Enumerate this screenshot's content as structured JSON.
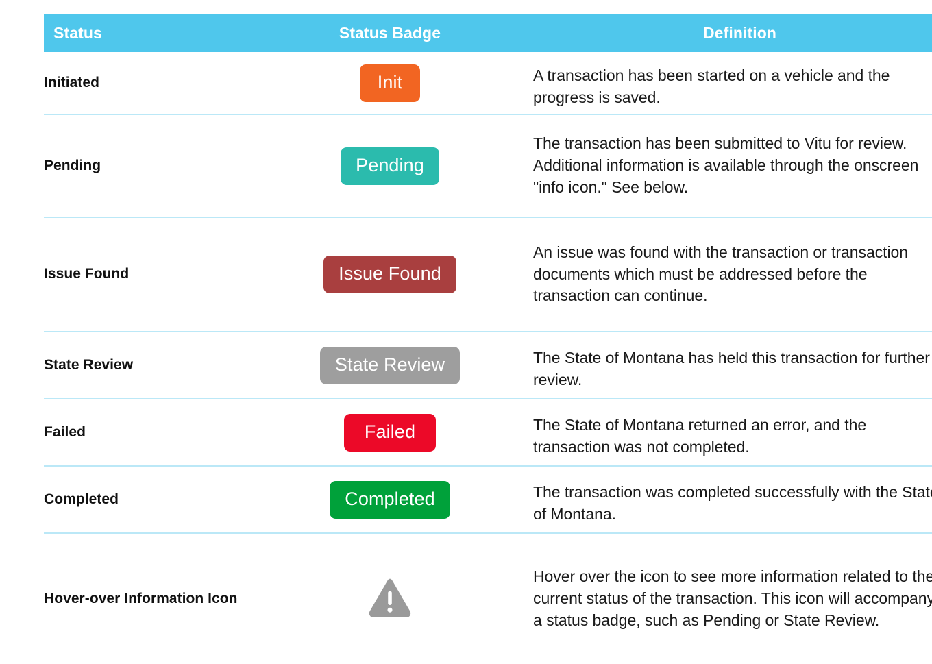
{
  "table": {
    "headers": {
      "status": "Status",
      "badge": "Status Badge",
      "definition": "Definition"
    },
    "header_bg": "#4FC7EC",
    "row_divider_color": "#BBE8F7",
    "rows": [
      {
        "status": "Initiated",
        "badge_label": "Init",
        "badge_color": "#F26522",
        "definition": "A transaction has been started on a vehicle and the progress is saved."
      },
      {
        "status": "Pending",
        "badge_label": "Pending",
        "badge_color": "#2BBBAD",
        "definition": "The transaction has been submitted to Vitu for review. Additional information is available through the onscreen \"info icon.\" See below."
      },
      {
        "status": "Issue Found",
        "badge_label": "Issue Found",
        "badge_color": "#A93F3F",
        "definition": "An issue was found with the transaction or transaction documents which must be addressed before the transaction can continue."
      },
      {
        "status": "State Review",
        "badge_label": "State Review",
        "badge_color": "#9E9E9E",
        "definition": "The State of Montana has held this transaction for further review."
      },
      {
        "status": "Failed",
        "badge_label": "Failed",
        "badge_color": "#EC0928",
        "definition": "The State of Montana returned an error, and the transaction was not completed."
      },
      {
        "status": "Completed",
        "badge_label": "Completed",
        "badge_color": "#00A13A",
        "definition": "The transaction was completed successfully with the State of Montana."
      },
      {
        "status": "Hover-over Information Icon",
        "badge_icon": "warning-triangle-icon",
        "badge_icon_color": "#9A9A9A",
        "definition": "Hover over the icon to see more information related to the current status of the transaction. This icon will accompany a status badge, such as Pending or State Review."
      }
    ]
  }
}
